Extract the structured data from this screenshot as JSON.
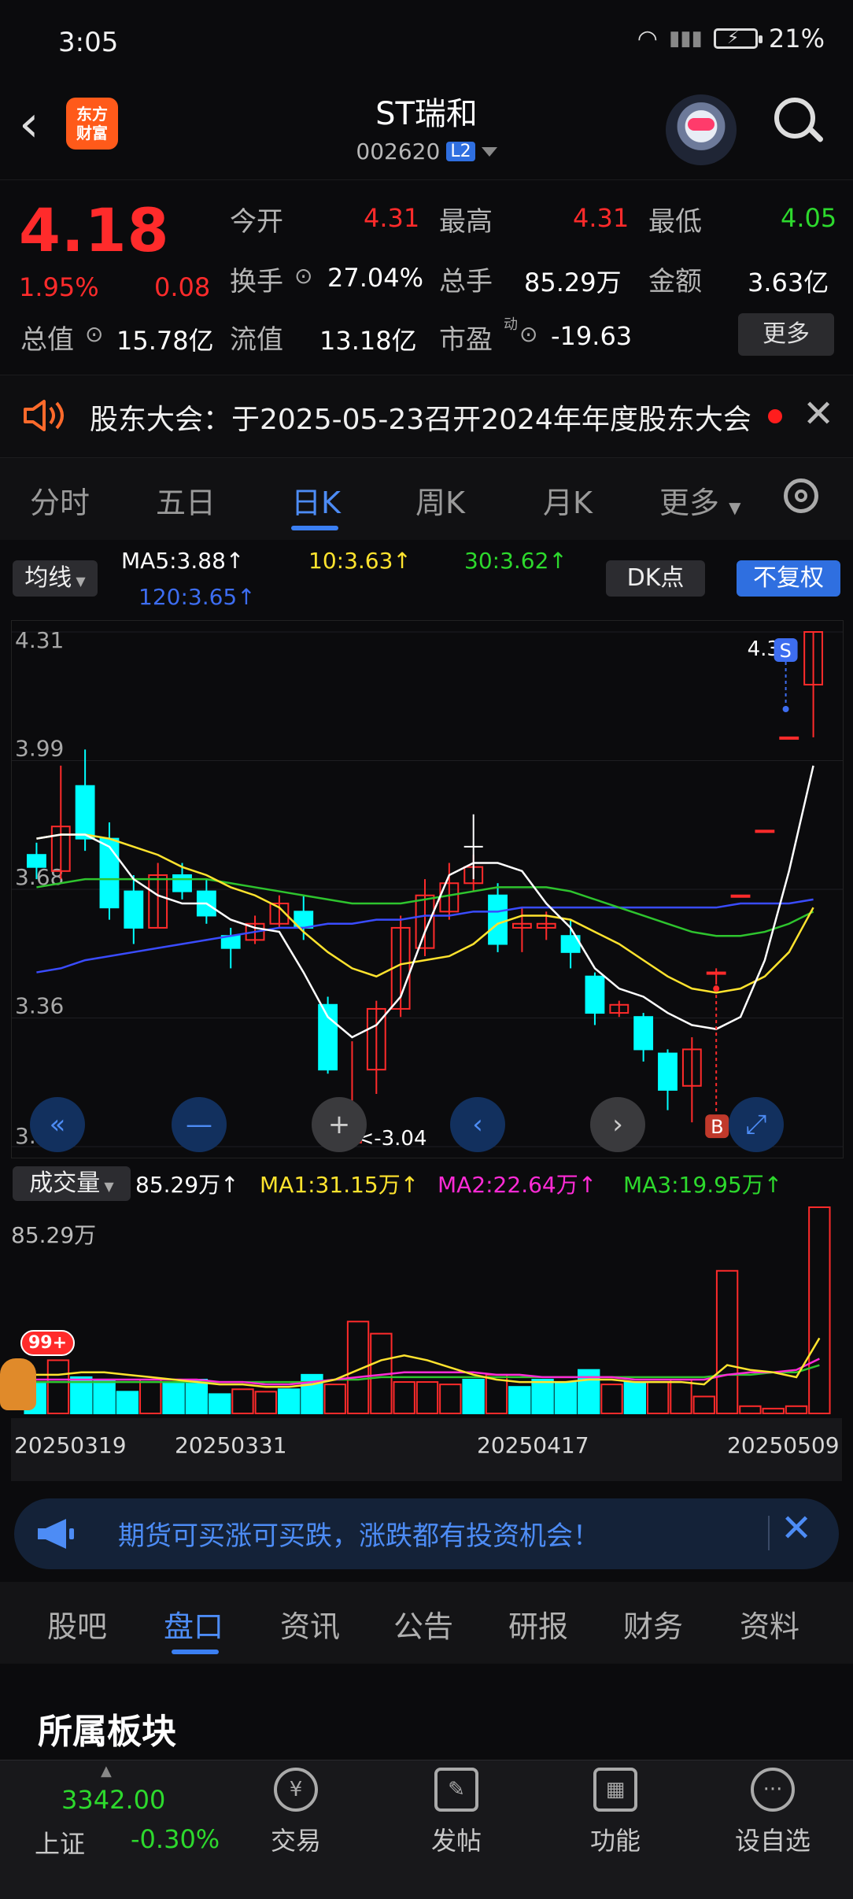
{
  "status": {
    "time": "3:05",
    "battery": "21%"
  },
  "header": {
    "logo_line1": "东方",
    "logo_line2": "财富",
    "name": "ST瑞和",
    "code": "002620",
    "level": "L2"
  },
  "quote": {
    "price": "4.18",
    "change_pct": "1.95%",
    "change": "0.08",
    "open_label": "今开",
    "open": "4.31",
    "high_label": "最高",
    "high": "4.31",
    "low_label": "最低",
    "low": "4.05",
    "turnover_label": "换手",
    "turnover": "27.04%",
    "volume_label": "总手",
    "volume": "85.29万",
    "amount_label": "金额",
    "amount": "3.63亿",
    "mktcap_label": "总值",
    "mktcap": "15.78亿",
    "float_label": "流值",
    "float": "13.18亿",
    "pe_label": "市盈",
    "pe_sup": "动",
    "pe": "-19.63",
    "more": "更多"
  },
  "notice": {
    "text": "股东大会：于2025-05-23召开2024年年度股东大会"
  },
  "tabs": [
    "分时",
    "五日",
    "日K",
    "周K",
    "月K",
    "更多"
  ],
  "chart_ctrl": {
    "ma_btn": "均线",
    "ma5": "MA5:3.88",
    "ma10": "10:3.63",
    "ma30": "30:3.62",
    "ma120": "120:3.65",
    "dk": "DK点",
    "fq": "不复权",
    "vol_btn": "成交量",
    "vol_now": "85.29万",
    "vol_ma1": "MA1:31.15万",
    "vol_ma2": "MA2:22.64万",
    "vol_ma3": "MA3:19.95万",
    "vol_max": "85.29万"
  },
  "chart_data": {
    "type": "candlestick",
    "y_axis_labels": [
      "4.31",
      "3.99",
      "3.68",
      "3.36",
      "3.04"
    ],
    "ylim": [
      3.04,
      4.31
    ],
    "max_label": "4.31",
    "min_label": "<-3.04",
    "dates": [
      "20250319",
      "20250331",
      "20250417",
      "20250509"
    ],
    "candles": [
      {
        "o": 3.76,
        "c": 3.73,
        "h": 3.79,
        "l": 3.7
      },
      {
        "o": 3.72,
        "c": 3.83,
        "h": 3.98,
        "l": 3.7
      },
      {
        "o": 3.93,
        "c": 3.8,
        "h": 4.02,
        "l": 3.77
      },
      {
        "o": 3.8,
        "c": 3.63,
        "h": 3.84,
        "l": 3.6
      },
      {
        "o": 3.67,
        "c": 3.58,
        "h": 3.71,
        "l": 3.54
      },
      {
        "o": 3.58,
        "c": 3.71,
        "h": 3.74,
        "l": 3.58
      },
      {
        "o": 3.71,
        "c": 3.67,
        "h": 3.74,
        "l": 3.65
      },
      {
        "o": 3.67,
        "c": 3.61,
        "h": 3.7,
        "l": 3.59
      },
      {
        "o": 3.56,
        "c": 3.53,
        "h": 3.58,
        "l": 3.48
      },
      {
        "o": 3.55,
        "c": 3.59,
        "h": 3.61,
        "l": 3.54
      },
      {
        "o": 3.59,
        "c": 3.64,
        "h": 3.66,
        "l": 3.58
      },
      {
        "o": 3.62,
        "c": 3.58,
        "h": 3.66,
        "l": 3.55
      },
      {
        "o": 3.39,
        "c": 3.23,
        "h": 3.41,
        "l": 3.22
      },
      {
        "o": 3.05,
        "c": 3.08,
        "h": 3.3,
        "l": 3.04
      },
      {
        "o": 3.23,
        "c": 3.38,
        "h": 3.4,
        "l": 3.17
      },
      {
        "o": 3.38,
        "c": 3.58,
        "h": 3.61,
        "l": 3.36
      },
      {
        "o": 3.53,
        "c": 3.66,
        "h": 3.7,
        "l": 3.51
      },
      {
        "o": 3.62,
        "c": 3.69,
        "h": 3.74,
        "l": 3.6
      },
      {
        "o": 3.69,
        "c": 3.73,
        "h": 3.76,
        "l": 3.67
      },
      {
        "o": 3.66,
        "c": 3.54,
        "h": 3.69,
        "l": 3.52
      },
      {
        "o": 3.58,
        "c": 3.59,
        "h": 3.63,
        "l": 3.52
      },
      {
        "o": 3.58,
        "c": 3.59,
        "h": 3.62,
        "l": 3.55
      },
      {
        "o": 3.56,
        "c": 3.52,
        "h": 3.6,
        "l": 3.48
      },
      {
        "o": 3.46,
        "c": 3.37,
        "h": 3.47,
        "l": 3.34
      },
      {
        "o": 3.37,
        "c": 3.39,
        "h": 3.4,
        "l": 3.36
      },
      {
        "o": 3.36,
        "c": 3.28,
        "h": 3.37,
        "l": 3.25
      },
      {
        "o": 3.27,
        "c": 3.18,
        "h": 3.28,
        "l": 3.13
      },
      {
        "o": 3.19,
        "c": 3.28,
        "h": 3.31,
        "l": 3.1
      },
      {
        "o": 3.47,
        "c": 3.47,
        "h": 3.48,
        "l": 3.44
      },
      {
        "o": 3.66,
        "c": 3.66,
        "h": 3.66,
        "l": 3.66
      },
      {
        "o": 3.82,
        "c": 3.82,
        "h": 3.82,
        "l": 3.82
      },
      {
        "o": 4.05,
        "c": 4.05,
        "h": 4.05,
        "l": 4.05
      },
      {
        "o": 4.18,
        "c": 4.31,
        "h": 4.31,
        "l": 4.05
      }
    ],
    "ma5": [
      3.8,
      3.81,
      3.81,
      3.78,
      3.7,
      3.66,
      3.64,
      3.64,
      3.6,
      3.58,
      3.57,
      3.47,
      3.36,
      3.31,
      3.34,
      3.41,
      3.57,
      3.71,
      3.74,
      3.74,
      3.72,
      3.64,
      3.58,
      3.48,
      3.43,
      3.41,
      3.37,
      3.34,
      3.33,
      3.36,
      3.5,
      3.72,
      3.98
    ],
    "ma10": [
      3.8,
      3.81,
      3.81,
      3.8,
      3.78,
      3.76,
      3.73,
      3.71,
      3.68,
      3.66,
      3.63,
      3.57,
      3.52,
      3.48,
      3.46,
      3.49,
      3.5,
      3.51,
      3.54,
      3.59,
      3.61,
      3.61,
      3.6,
      3.57,
      3.54,
      3.5,
      3.46,
      3.43,
      3.42,
      3.43,
      3.46,
      3.52,
      3.63
    ],
    "ma30": [
      3.68,
      3.69,
      3.7,
      3.7,
      3.7,
      3.7,
      3.7,
      3.7,
      3.69,
      3.68,
      3.67,
      3.66,
      3.65,
      3.64,
      3.64,
      3.64,
      3.65,
      3.66,
      3.67,
      3.68,
      3.68,
      3.68,
      3.67,
      3.65,
      3.63,
      3.61,
      3.59,
      3.57,
      3.56,
      3.56,
      3.57,
      3.59,
      3.62
    ],
    "ma120": [
      3.47,
      3.48,
      3.5,
      3.51,
      3.52,
      3.53,
      3.54,
      3.55,
      3.56,
      3.57,
      3.58,
      3.58,
      3.59,
      3.59,
      3.6,
      3.6,
      3.61,
      3.61,
      3.62,
      3.62,
      3.63,
      3.63,
      3.63,
      3.63,
      3.63,
      3.63,
      3.63,
      3.63,
      3.63,
      3.64,
      3.64,
      3.64,
      3.65
    ],
    "volume": [
      13,
      22,
      15,
      14,
      9,
      14,
      13,
      14,
      8,
      10,
      9,
      10,
      16,
      12,
      38,
      33,
      13,
      13,
      12,
      14,
      16,
      11,
      14,
      13,
      18,
      12,
      13,
      13,
      14,
      7,
      59,
      3,
      2,
      3,
      85.29
    ],
    "vol_ma1": [
      16,
      16,
      17,
      17,
      16,
      15,
      14,
      13,
      12,
      12,
      11,
      11,
      12,
      14,
      18,
      22,
      24,
      22,
      19,
      16,
      14,
      13,
      13,
      13,
      14,
      14,
      13,
      13,
      13,
      12,
      20,
      18,
      17,
      15,
      31.15
    ],
    "vol_ma2": [
      14,
      14,
      14,
      14,
      14,
      14,
      14,
      14,
      13,
      13,
      12,
      12,
      13,
      14,
      15,
      16,
      17,
      17,
      17,
      17,
      16,
      16,
      15,
      15,
      15,
      15,
      14,
      14,
      14,
      14,
      16,
      17,
      17,
      18,
      22.64
    ],
    "vol_ma3": [
      13,
      13,
      13,
      13,
      13,
      13,
      13,
      13,
      13,
      13,
      13,
      13,
      13,
      14,
      14,
      15,
      15,
      15,
      15,
      15,
      15,
      15,
      15,
      15,
      15,
      15,
      15,
      15,
      15,
      15,
      16,
      16,
      17,
      17,
      19.95
    ],
    "colors": {
      "up": "#ff2b2b",
      "down": "#00ffff",
      "ma5": "#ffffff",
      "ma10": "#ffe32e",
      "ma30": "#2ec42e",
      "ma120": "#3a4cff"
    }
  },
  "ad": {
    "text": "期货可买涨可买跌，涨跌都有投资机会！"
  },
  "subtabs": [
    "股吧",
    "盘口",
    "资讯",
    "公告",
    "研报",
    "财务",
    "资料"
  ],
  "section_title": "所属板块",
  "footer": {
    "index_value": "3342.00",
    "index_name": "上证",
    "index_change": "-0.30%",
    "nav": [
      "交易",
      "发帖",
      "功能",
      "设自选"
    ]
  },
  "badge": "99+"
}
